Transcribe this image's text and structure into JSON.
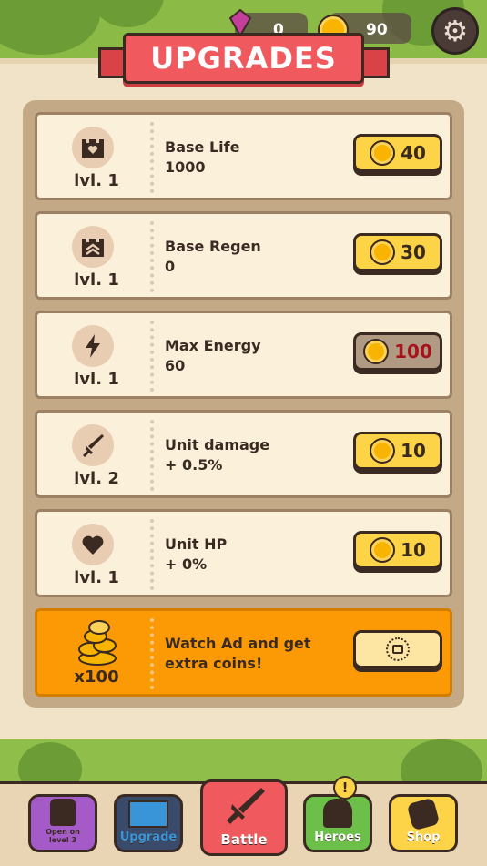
{
  "header": {
    "gems": "0",
    "coins": "90",
    "title": "UPGRADES"
  },
  "upgrades": [
    {
      "level": "lvl. 1",
      "name": "Base Life",
      "value": "1000",
      "price": "40",
      "icon": "castle-heart-icon",
      "affordable": true
    },
    {
      "level": "lvl. 1",
      "name": "Base Regen",
      "value": "0",
      "price": "30",
      "icon": "castle-regen-icon",
      "affordable": true
    },
    {
      "level": "lvl. 1",
      "name": "Max Energy",
      "value": "60",
      "price": "100",
      "icon": "lightning-icon",
      "affordable": false
    },
    {
      "level": "lvl. 2",
      "name": "Unit damage",
      "value": "+ 0.5%",
      "price": "10",
      "icon": "sword-icon",
      "affordable": true
    },
    {
      "level": "lvl. 1",
      "name": "Unit HP",
      "value": "+ 0%",
      "price": "10",
      "icon": "heart-icon",
      "affordable": true
    }
  ],
  "ad_offer": {
    "amount": "x100",
    "text_line1": "Watch Ad and get",
    "text_line2": "extra coins!"
  },
  "nav": {
    "locked_label_line1": "Open on",
    "locked_label_line2": "level 3",
    "upgrade": "Upgrade",
    "battle": "Battle",
    "heroes": "Heroes",
    "heroes_badge": "!",
    "shop": "Shop"
  },
  "colors": {
    "banner": "#f05a5e",
    "price_button": "#fdd447",
    "ad_card": "#fb9a05",
    "battle_button": "#f05a5e",
    "heroes_button": "#6cc04a",
    "shop_button": "#fdd447",
    "upgrade_button": "#3a95d8",
    "locked_button": "#a45bc7"
  }
}
